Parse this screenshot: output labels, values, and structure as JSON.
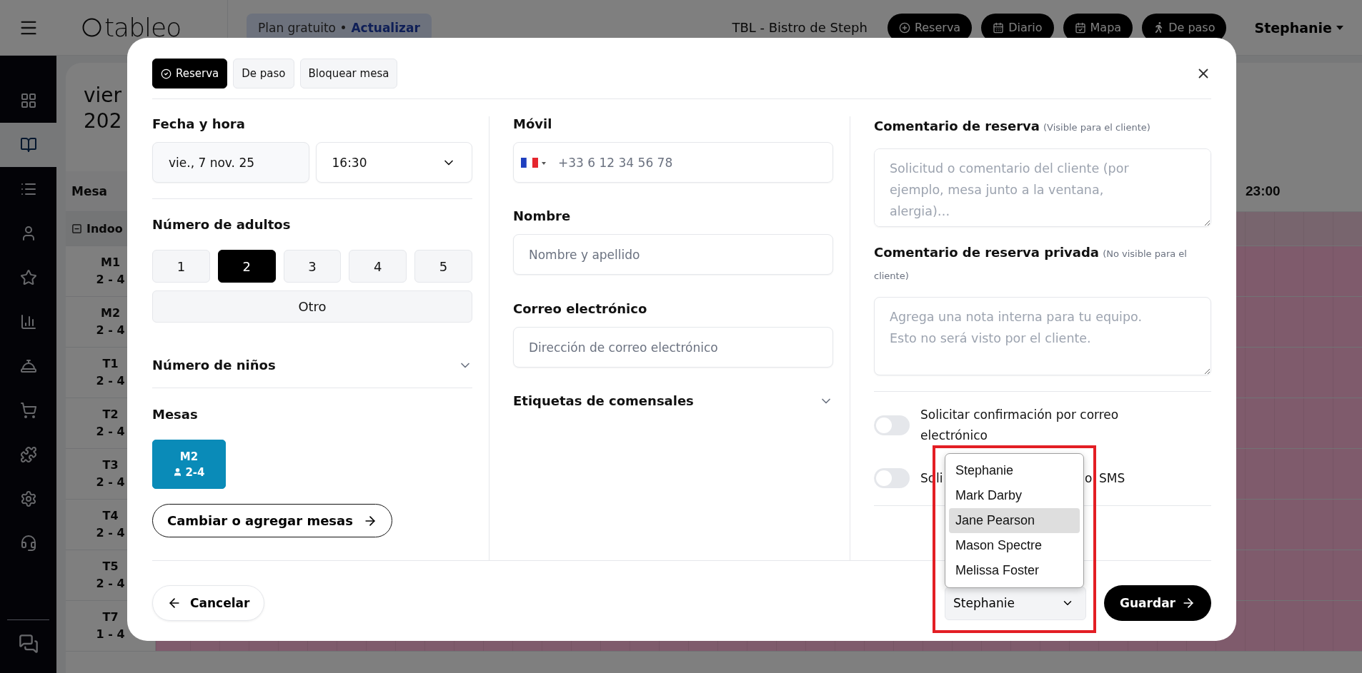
{
  "top_bar": {
    "brand": "tableo",
    "plan_chip": {
      "plan": "Plan gratuito •",
      "link": "Actualizar"
    },
    "venue": "TBL - Bistro de Steph",
    "actions": [
      {
        "label": "Reserva",
        "kind": "plus"
      },
      {
        "label": "Diario",
        "kind": "calendar"
      },
      {
        "label": "Mapa",
        "kind": "map"
      },
      {
        "label": "De paso",
        "kind": "walk"
      }
    ],
    "user": "Stephanie"
  },
  "sidebar": {
    "items": [
      {
        "kind": "dashboard",
        "selected": false
      },
      {
        "kind": "book",
        "selected": true
      },
      {
        "kind": "list",
        "selected": false
      },
      {
        "kind": "user",
        "selected": false
      },
      {
        "kind": "star",
        "selected": false
      },
      {
        "kind": "chart",
        "selected": false
      },
      {
        "kind": "bell",
        "selected": false
      },
      {
        "kind": "cart",
        "selected": false
      },
      {
        "kind": "puzzle",
        "selected": false
      },
      {
        "kind": "settings",
        "selected": false
      },
      {
        "kind": "headset",
        "selected": false
      }
    ]
  },
  "schedule": {
    "title_lines": [
      "vier",
      "202"
    ],
    "column_header": "Mesa",
    "time_header": "23:00",
    "group": {
      "label": "Indoo",
      "expanded": true
    },
    "rows": [
      {
        "table": "M1",
        "capacity": "2 - 4"
      },
      {
        "table": "M2",
        "capacity": "2 - 4"
      },
      {
        "table": "T1",
        "capacity": "2 - 4"
      },
      {
        "table": "T2",
        "capacity": "2 - 4"
      },
      {
        "table": "T3",
        "capacity": "2 - 4"
      },
      {
        "table": "T4",
        "capacity": "2 - 4"
      },
      {
        "table": "T5",
        "capacity": "2 - 4"
      },
      {
        "table": "T7",
        "capacity": "1 - 4"
      }
    ]
  },
  "modal": {
    "tabs": [
      {
        "label": "Reserva",
        "selected": true
      },
      {
        "label": "De paso",
        "selected": false
      },
      {
        "label": "Bloquear mesa",
        "selected": false
      }
    ],
    "date_time": {
      "label": "Fecha y hora",
      "date": "vie., 7 nov. 25",
      "time": "16:30"
    },
    "adults": {
      "label": "Número de adultos",
      "options": [
        {
          "label": "1",
          "selected": false
        },
        {
          "label": "2",
          "selected": true
        },
        {
          "label": "3",
          "selected": false
        },
        {
          "label": "4",
          "selected": false
        },
        {
          "label": "5",
          "selected": false
        }
      ],
      "other": "Otro"
    },
    "children": {
      "label": "Número de niños",
      "expanded": false
    },
    "tables": {
      "label": "Mesas",
      "items": [
        {
          "name": "M2",
          "capacity": "2-4",
          "selected": true
        }
      ],
      "change_button": "Cambiar o agregar mesas"
    },
    "mobile": {
      "label": "Móvil",
      "placeholder": "+33 6 12 34 56 78"
    },
    "name": {
      "label": "Nombre",
      "placeholder": "Nombre y apellido"
    },
    "email": {
      "label": "Correo electrónico",
      "placeholder": "Dirección de correo electrónico"
    },
    "tags": {
      "label": "Etiquetas de comensales",
      "expanded": false
    },
    "comment": {
      "label": "Comentario de reserva",
      "hint": "(Visible para el cliente)",
      "placeholder": "Solicitud o comentario del cliente (por ejemplo, mesa junto a la ventana, alergia)…"
    },
    "private_comment": {
      "label": "Comentario de reserva privada",
      "hint": "(No visible para el cliente)",
      "placeholder": "Agrega una nota interna para tu equipo. Esto no será visto por el cliente."
    },
    "toggles": [
      {
        "label_parts": [
          "Solicitar confirmación por correo electrónico"
        ],
        "on": false
      },
      {
        "label_parts": [
          "So",
          "li",
          "o",
          "SMS"
        ],
        "on": false
      }
    ],
    "staff_select": {
      "value": "Stephanie",
      "expanded": true,
      "options": [
        {
          "label": "Stephanie",
          "highlighted": false
        },
        {
          "label": "Mark Darby",
          "highlighted": false
        },
        {
          "label": "Jane Pearson",
          "highlighted": true
        },
        {
          "label": "Mason Spectre",
          "highlighted": false
        },
        {
          "label": "Melissa Foster",
          "highlighted": false
        }
      ]
    },
    "cancel": "Cancelar",
    "save": "Guardar"
  }
}
